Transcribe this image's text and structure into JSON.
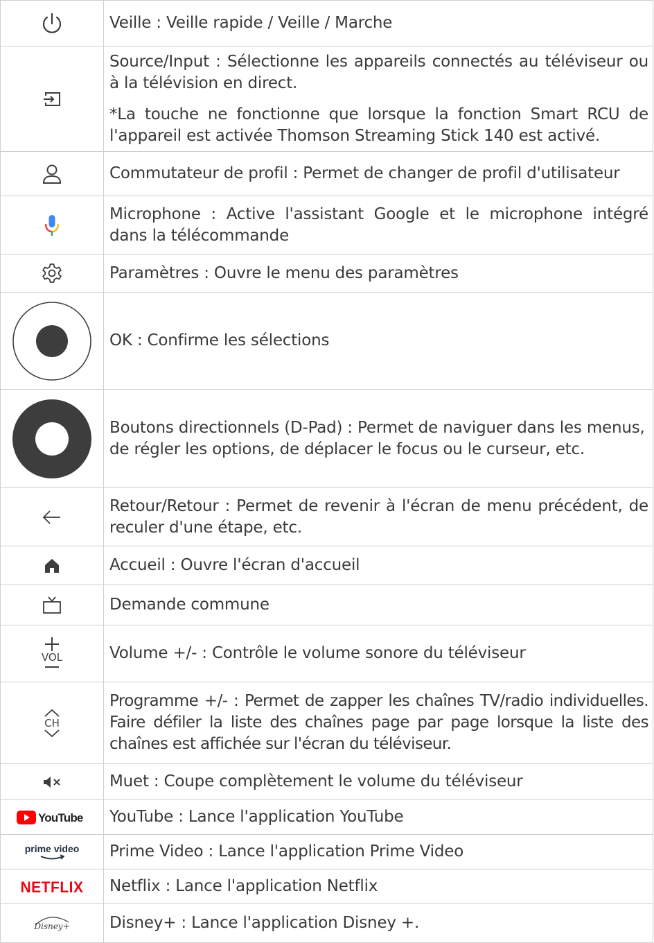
{
  "rows": [
    {
      "icon": "power-icon",
      "text": "Veille : Veille rapide / Veille / Marche"
    },
    {
      "icon": "source-input-icon",
      "text": "Source/Input : Sélectionne les appareils connectés au téléviseur ou à la télévision en direct.",
      "note": "*La touche ne fonctionne que lorsque la fonction Smart RCU de l'appareil est activée Thomson Streaming Stick 140 est activé."
    },
    {
      "icon": "profile-icon",
      "text": "Commutateur de profil : Permet de changer de profil d'utilisateur"
    },
    {
      "icon": "microphone-icon",
      "text": "Microphone : Active l'assistant Google et le microphone intégré dans la télécommande"
    },
    {
      "icon": "settings-gear-icon",
      "text": "Paramètres : Ouvre le menu des paramètres"
    },
    {
      "icon": "ok-button-icon",
      "text": "OK : Confirme les sélections"
    },
    {
      "icon": "dpad-icon",
      "text": "Boutons directionnels (D-Pad) : Permet de naviguer dans les menus, de régler les options, de déplacer le focus ou le curseur, etc."
    },
    {
      "icon": "back-arrow-icon",
      "text": "Retour/Retour : Permet de revenir à l'écran de menu précédent, de reculer d'une étape, etc."
    },
    {
      "icon": "home-icon",
      "text": "Accueil : Ouvre l'écran d'accueil"
    },
    {
      "icon": "live-tv-icon",
      "text": "Demande commune"
    },
    {
      "icon": "volume-icon",
      "label": "VOL",
      "text": "Volume +/- : Contrôle le volume sonore du téléviseur"
    },
    {
      "icon": "channel-icon",
      "label": "CH",
      "text": "Programme +/- : Permet de zapper les chaînes TV/radio individuelles. Faire défiler la liste des chaînes page par page lorsque la liste des chaînes est affichée sur l'écran du téléviseur."
    },
    {
      "icon": "mute-icon",
      "text": "Muet : Coupe complètement le volume du téléviseur"
    },
    {
      "icon": "youtube-logo",
      "label": "YouTube",
      "text": "YouTube : Lance l'application YouTube"
    },
    {
      "icon": "prime-video-logo",
      "label": "prime video",
      "text": "Prime Video : Lance l'application Prime Video"
    },
    {
      "icon": "netflix-logo",
      "label": "NETFLIX",
      "text": "Netflix : Lance l'application Netflix"
    },
    {
      "icon": "disney-plus-logo",
      "label": "Disney+",
      "text": "Disney+ : Lance l'application Disney +."
    }
  ],
  "colors": {
    "border": "#cfcfcf",
    "text": "#3a3a3a",
    "icon": "#3d3d3d",
    "youtube_red": "#ff0000",
    "netflix_red": "#e50914",
    "mic_blue": "#4285f4",
    "mic_red": "#ea4335",
    "mic_yellow": "#fbbc05",
    "mic_green": "#34a853"
  }
}
